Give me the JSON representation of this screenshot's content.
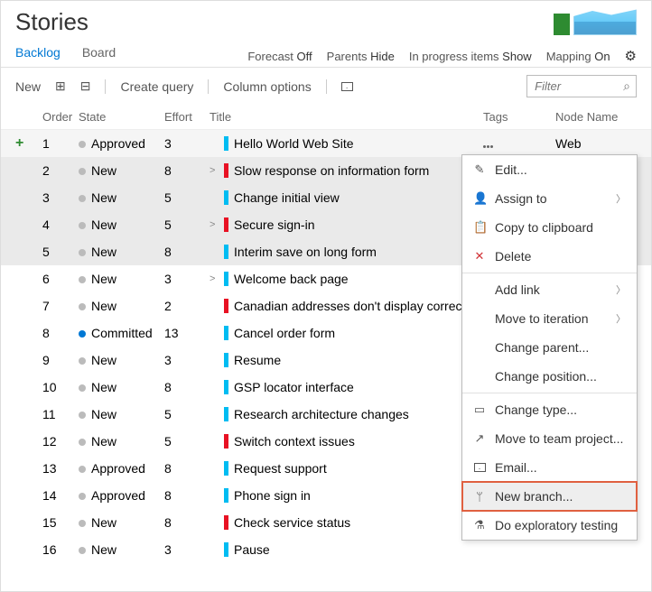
{
  "title": "Stories",
  "tabs": {
    "backlog": "Backlog",
    "board": "Board"
  },
  "toolbar": {
    "forecast_label": "Forecast",
    "forecast_value": "Off",
    "parents_label": "Parents",
    "parents_value": "Hide",
    "inprogress_label": "In progress items",
    "inprogress_value": "Show",
    "mapping_label": "Mapping",
    "mapping_value": "On"
  },
  "actions": {
    "new": "New",
    "create_query": "Create query",
    "column_options": "Column options",
    "filter_placeholder": "Filter"
  },
  "columns": {
    "order": "Order",
    "state": "State",
    "effort": "Effort",
    "title": "Title",
    "tags": "Tags",
    "node": "Node Name"
  },
  "node_value": "Web",
  "rows": [
    {
      "order": "1",
      "state": "Approved",
      "effort": "3",
      "bar": "blue",
      "chev": "",
      "title": "Hello World Web Site",
      "first": true
    },
    {
      "order": "2",
      "state": "New",
      "effort": "8",
      "bar": "red",
      "chev": ">",
      "title": "Slow response on information form",
      "sel": true
    },
    {
      "order": "3",
      "state": "New",
      "effort": "5",
      "bar": "blue",
      "chev": "",
      "title": "Change initial view",
      "sel": true
    },
    {
      "order": "4",
      "state": "New",
      "effort": "5",
      "bar": "red",
      "chev": ">",
      "title": "Secure sign-in",
      "sel": true
    },
    {
      "order": "5",
      "state": "New",
      "effort": "8",
      "bar": "blue",
      "chev": "",
      "title": "Interim save on long form",
      "sel": true
    },
    {
      "order": "6",
      "state": "New",
      "effort": "3",
      "bar": "blue",
      "chev": ">",
      "title": "Welcome back page"
    },
    {
      "order": "7",
      "state": "New",
      "effort": "2",
      "bar": "red",
      "chev": "",
      "title": "Canadian addresses don't display correctly"
    },
    {
      "order": "8",
      "state": "Committed",
      "effort": "13",
      "bar": "blue",
      "chev": "",
      "title": "Cancel order form",
      "blue": true
    },
    {
      "order": "9",
      "state": "New",
      "effort": "3",
      "bar": "blue",
      "chev": "",
      "title": "Resume"
    },
    {
      "order": "10",
      "state": "New",
      "effort": "8",
      "bar": "blue",
      "chev": "",
      "title": "GSP locator interface"
    },
    {
      "order": "11",
      "state": "New",
      "effort": "5",
      "bar": "blue",
      "chev": "",
      "title": "Research architecture changes"
    },
    {
      "order": "12",
      "state": "New",
      "effort": "5",
      "bar": "red",
      "chev": "",
      "title": "Switch context issues"
    },
    {
      "order": "13",
      "state": "Approved",
      "effort": "8",
      "bar": "blue",
      "chev": "",
      "title": "Request support"
    },
    {
      "order": "14",
      "state": "Approved",
      "effort": "8",
      "bar": "blue",
      "chev": "",
      "title": "Phone sign in"
    },
    {
      "order": "15",
      "state": "New",
      "effort": "8",
      "bar": "red",
      "chev": "",
      "title": "Check service status"
    },
    {
      "order": "16",
      "state": "New",
      "effort": "3",
      "bar": "blue",
      "chev": "",
      "title": "Pause"
    }
  ],
  "menu": {
    "edit": "Edit...",
    "assign": "Assign to",
    "copy": "Copy to clipboard",
    "delete": "Delete",
    "addlink": "Add link",
    "move_iter": "Move to iteration",
    "change_parent": "Change parent...",
    "change_pos": "Change position...",
    "change_type": "Change type...",
    "move_proj": "Move to team project...",
    "email": "Email...",
    "new_branch": "New branch...",
    "explore": "Do exploratory testing"
  }
}
